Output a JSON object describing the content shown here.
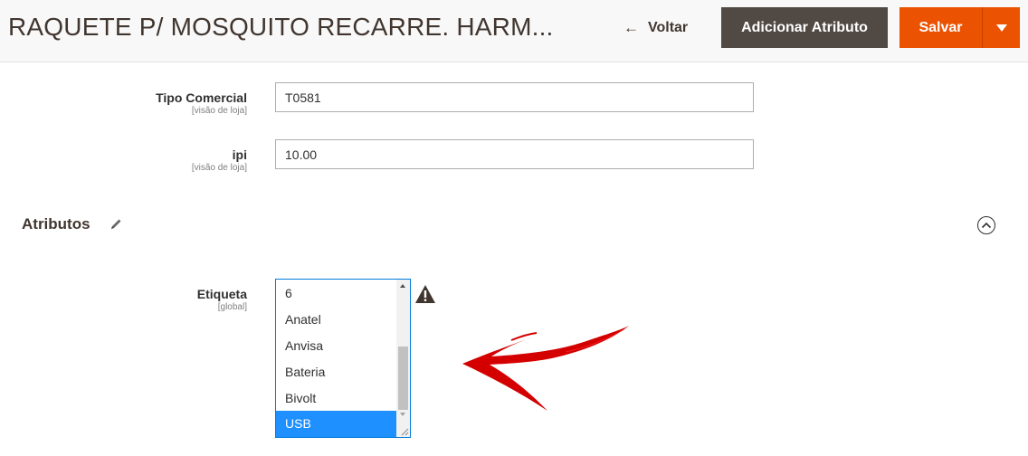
{
  "header": {
    "title": "RAQUETE P/ MOSQUITO RECARRE. HARM...",
    "back_label": "Voltar",
    "add_attribute_label": "Adicionar Atributo",
    "save_label": "Salvar"
  },
  "fields": [
    {
      "label": "Tipo Comercial",
      "scope": "[visão de loja]",
      "value": "T0581"
    },
    {
      "label": "ipi",
      "scope": "[visão de loja]",
      "value": "10.00"
    }
  ],
  "attributes_section": {
    "title": "Atributos",
    "etiqueta": {
      "label": "Etiqueta",
      "scope": "[global]",
      "options": [
        "6",
        "Anatel",
        "Anvisa",
        "Bateria",
        "Bivolt",
        "USB"
      ],
      "selected": "USB"
    }
  },
  "colors": {
    "accent": "#eb5202",
    "secondary_button": "#514943",
    "selection": "#1e90ff",
    "annotation_arrow": "#e00000"
  },
  "icons": [
    "back-arrow-icon",
    "caret-down-icon",
    "pencil-icon",
    "collapse-chevron-up-icon",
    "warning-icon",
    "red-arrow-annotation"
  ]
}
